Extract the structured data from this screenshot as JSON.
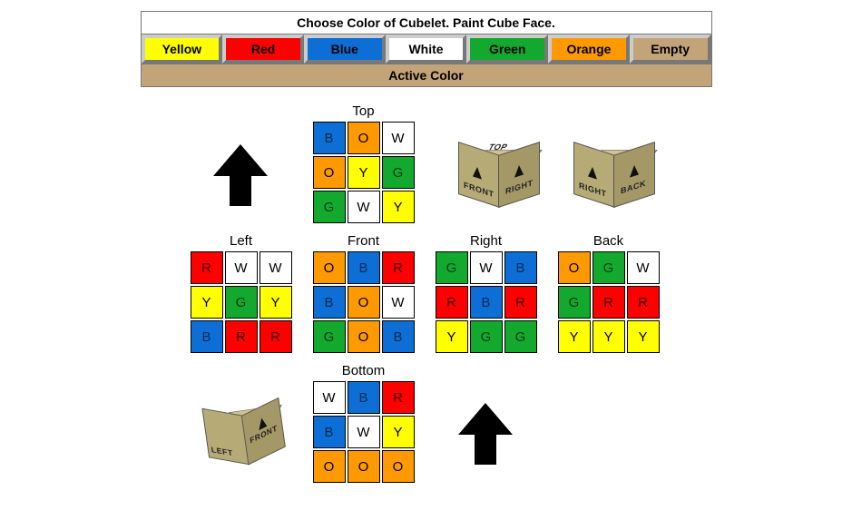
{
  "palette": {
    "title": "Choose Color of Cubelet. Paint Cube Face.",
    "active_label": "Active Color",
    "buttons": [
      {
        "label": "Yellow",
        "bg": "#ffff00",
        "fg": "#000000"
      },
      {
        "label": "Red",
        "bg": "#ff0000",
        "fg": "#000000"
      },
      {
        "label": "Blue",
        "bg": "#0d6fd6",
        "fg": "#000000"
      },
      {
        "label": "White",
        "bg": "#ffffff",
        "fg": "#000000"
      },
      {
        "label": "Green",
        "bg": "#13a92e",
        "fg": "#000000"
      },
      {
        "label": "Orange",
        "bg": "#ff9900",
        "fg": "#000000"
      },
      {
        "label": "Empty",
        "bg": "#c3a478",
        "fg": "#000000"
      }
    ]
  },
  "color_map": {
    "Y": "#ffff00",
    "R": "#ff0000",
    "B": "#0d6fd6",
    "W": "#ffffff",
    "G": "#13a92e",
    "O": "#ff9900",
    "E": "#c3a478"
  },
  "text_color_map": {
    "Y": "#000000",
    "R": "#3b0000",
    "B": "#0a2a55",
    "W": "#000000",
    "G": "#0a3a14",
    "O": "#000000",
    "E": "#000000"
  },
  "faces": {
    "top": {
      "title": "Top",
      "cells": [
        "B",
        "O",
        "W",
        "O",
        "Y",
        "G",
        "G",
        "W",
        "Y"
      ]
    },
    "left": {
      "title": "Left",
      "cells": [
        "R",
        "W",
        "W",
        "Y",
        "G",
        "Y",
        "B",
        "R",
        "R"
      ]
    },
    "front": {
      "title": "Front",
      "cells": [
        "O",
        "B",
        "R",
        "B",
        "O",
        "W",
        "G",
        "O",
        "B"
      ]
    },
    "right": {
      "title": "Right",
      "cells": [
        "G",
        "W",
        "B",
        "R",
        "B",
        "R",
        "Y",
        "G",
        "G"
      ]
    },
    "back": {
      "title": "Back",
      "cells": [
        "O",
        "G",
        "W",
        "G",
        "R",
        "R",
        "Y",
        "Y",
        "Y"
      ]
    },
    "bottom": {
      "title": "Bottom",
      "cells": [
        "W",
        "B",
        "R",
        "B",
        "W",
        "Y",
        "O",
        "O",
        "O"
      ]
    }
  },
  "iso_labels": {
    "cube1": {
      "top": "TOP",
      "left": "FRONT",
      "right": "RIGHT"
    },
    "cube2": {
      "left": "RIGHT",
      "right": "BACK"
    },
    "cube3": {
      "right": "FRONT",
      "left": "LEFT"
    }
  }
}
